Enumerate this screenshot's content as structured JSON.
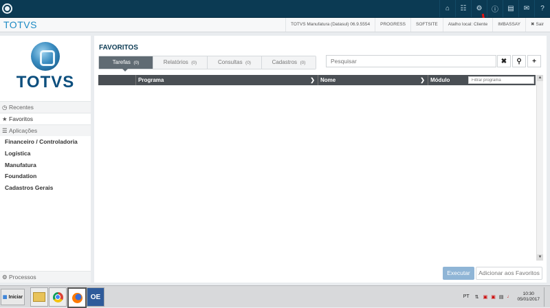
{
  "topbar": {
    "icons": [
      "home-icon",
      "sitemap-icon",
      "gear-icon",
      "info-icon",
      "document-icon",
      "mail-icon",
      "help-icon"
    ]
  },
  "brandbar": {
    "brand": "TOTVS",
    "product": "TOTVS Manufatura (Datasul) 06.9.5554",
    "env": "PROGRESS",
    "company": "SOFTSITE",
    "shortcut": "Atalho local: Cliente",
    "user": "IMBASSAY",
    "logout": "Sair"
  },
  "sidebar": {
    "logo_word": "TOTVS",
    "recentes": "Recentes",
    "favoritos": "Favoritos",
    "aplicacoes": "Aplicações",
    "apps": [
      "Financeiro / Controladoria",
      "Logística",
      "Manufatura",
      "Foundation",
      "Cadastros Gerais"
    ],
    "processos": "Processos"
  },
  "main": {
    "title": "FAVORITOS",
    "tabs": [
      {
        "label": "Tarefas",
        "count": "(0)"
      },
      {
        "label": "Relatórios",
        "count": "(0)"
      },
      {
        "label": "Consultas",
        "count": "(0)"
      },
      {
        "label": "Cadastros",
        "count": "(0)"
      }
    ],
    "search_placeholder": "Pesquisar",
    "columns": [
      "Programa",
      "Nome",
      "Módulo"
    ],
    "filter_placeholder": "Filtrar programa",
    "execute": "Executar",
    "add_favorites": "Adicionar aos Favoritos"
  },
  "taskbar": {
    "start": "Iniciar",
    "lang": "PT",
    "time": "10:30",
    "date": "05/01/2017"
  },
  "colors": {
    "topbar": "#0b3a53",
    "brand": "#1c8ac4",
    "active_tab": "#606b73",
    "execute_button": "#8fb5d6"
  }
}
